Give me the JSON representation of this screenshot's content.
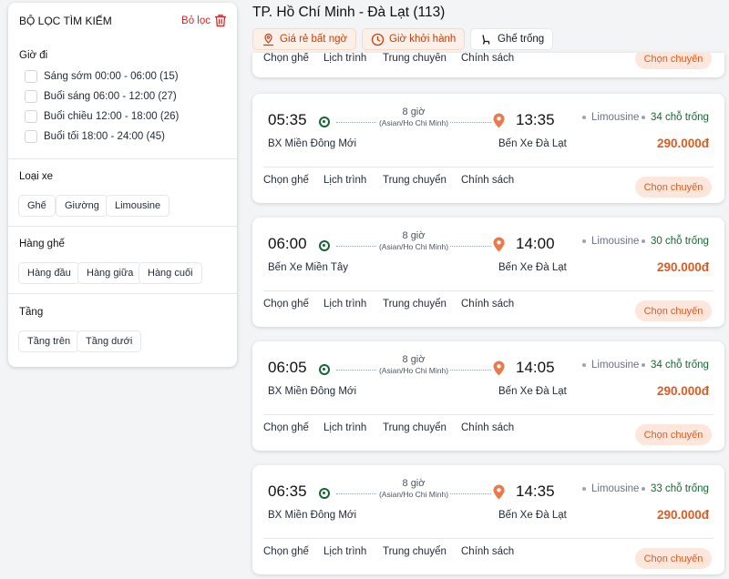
{
  "sidebar": {
    "title": "BỘ LỌC TÌM KIẾM",
    "clear_label": "Bỏ lọc",
    "departure_time": {
      "title": "Giờ đi",
      "options": [
        {
          "label": "Sáng sớm 00:00 - 06:00 (15)"
        },
        {
          "label": "Buổi sáng 06:00 - 12:00 (27)"
        },
        {
          "label": "Buổi chiều 12:00 - 18:00 (26)"
        },
        {
          "label": "Buổi tối 18:00 - 24:00 (45)"
        }
      ]
    },
    "vehicle_type": {
      "title": "Loại xe",
      "options": [
        "Ghế",
        "Giường",
        "Limousine"
      ]
    },
    "seat_row": {
      "title": "Hàng ghế",
      "options": [
        "Hàng đầu",
        "Hàng giữa",
        "Hàng cuối"
      ]
    },
    "floor": {
      "title": "Tầng",
      "options": [
        "Tầng trên",
        "Tầng dưới"
      ]
    }
  },
  "header": {
    "route_title": "TP. Hồ Chí Minh - Đà Lạt (113)",
    "filters": [
      {
        "label": "Giá rẻ bất ngờ",
        "icon": "location-price-icon",
        "highlighted": true
      },
      {
        "label": "Giờ khởi hành",
        "icon": "clock-icon",
        "highlighted": true
      },
      {
        "label": "Ghế trống",
        "icon": "seat-icon",
        "highlighted": false
      }
    ]
  },
  "trip_links": [
    "Chọn ghế",
    "Lịch trình",
    "Trung chuyển",
    "Chính sách"
  ],
  "choose_label": "Chọn chuyến",
  "trips": [
    {
      "dep": "05:35",
      "arr": "13:35",
      "duration": "8 giờ",
      "timezone": "(Asian/Ho Chi Minh)",
      "from": "BX Miền Đông Mới",
      "to": "Bến Xe Đà Lạt",
      "bus_type": "Limousine",
      "seats": "34 chỗ trống",
      "price": "290.000đ"
    },
    {
      "dep": "06:00",
      "arr": "14:00",
      "duration": "8 giờ",
      "timezone": "(Asian/Ho Chi Minh)",
      "from": "Bến Xe Miền Tây",
      "to": "Bến Xe Đà Lạt",
      "bus_type": "Limousine",
      "seats": "30 chỗ trống",
      "price": "290.000đ"
    },
    {
      "dep": "06:05",
      "arr": "14:05",
      "duration": "8 giờ",
      "timezone": "(Asian/Ho Chi Minh)",
      "from": "BX Miền Đông Mới",
      "to": "Bến Xe Đà Lạt",
      "bus_type": "Limousine",
      "seats": "34 chỗ trống",
      "price": "290.000đ"
    },
    {
      "dep": "06:35",
      "arr": "14:35",
      "duration": "8 giờ",
      "timezone": "(Asian/Ho Chi Minh)",
      "from": "BX Miền Đông Mới",
      "to": "Bến Xe Đà Lạt",
      "bus_type": "Limousine",
      "seats": "33 chỗ trống",
      "price": "290.000đ"
    }
  ],
  "colors": {
    "accent": "#e05a1e",
    "accent_bg": "#fde7dc",
    "available": "#166534",
    "danger": "#dc2626"
  }
}
